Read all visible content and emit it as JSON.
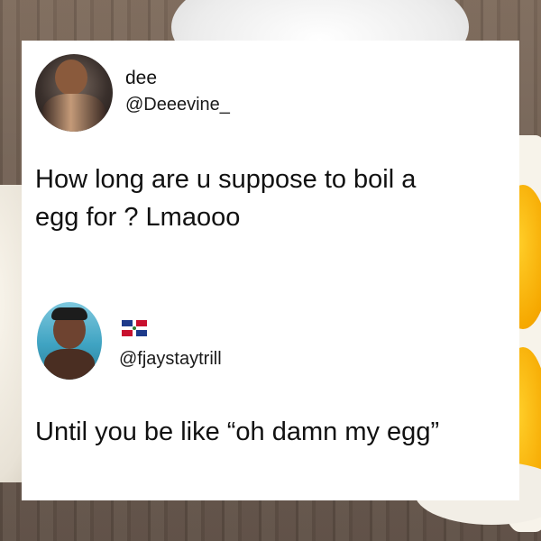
{
  "post": {
    "author": {
      "name": "dee",
      "handle": "@Deeevine_"
    },
    "text": "How long are u suppose to boil a\negg for ? Lmaooo"
  },
  "reply": {
    "author": {
      "handle": "@fjaystaytrill",
      "flag_icon": "dominican-republic-flag-icon"
    },
    "text": "Until you be like “oh damn my egg”"
  }
}
